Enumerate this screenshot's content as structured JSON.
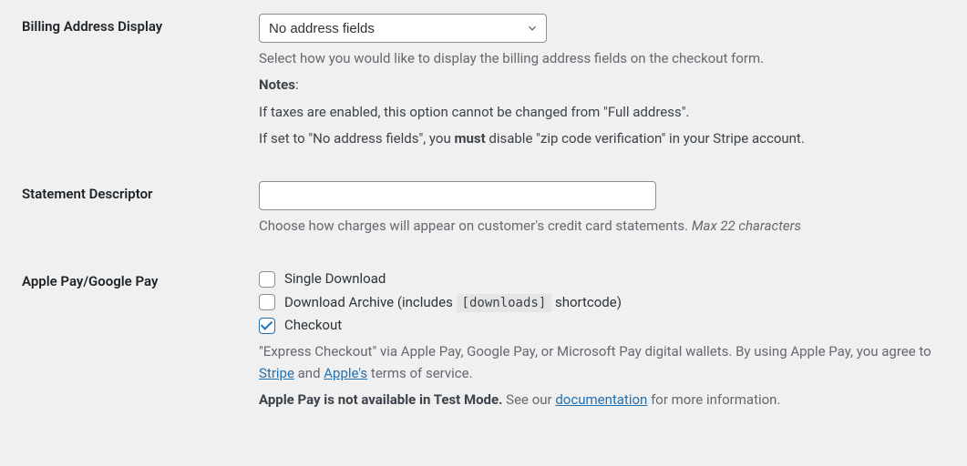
{
  "billing": {
    "label": "Billing Address Display",
    "select_value": "No address fields",
    "desc1": "Select how you would like to display the billing address fields on the checkout form.",
    "notes_label": "Notes",
    "notes_colon": ":",
    "note1": "If taxes are enabled, this option cannot be changed from \"Full address\".",
    "note2_a": "If set to \"No address fields\", you ",
    "note2_strong": "must",
    "note2_b": " disable \"zip code verification\" in your Stripe account."
  },
  "statement": {
    "label": "Statement Descriptor",
    "value": "",
    "desc_a": "Choose how charges will appear on customer's credit card statements. ",
    "desc_italic": "Max 22 characters"
  },
  "applepay": {
    "label": "Apple Pay/Google Pay",
    "cb1_label": "Single Download",
    "cb1_checked": false,
    "cb2_a": "Download Archive (includes ",
    "cb2_code": "[downloads]",
    "cb2_b": " shortcode)",
    "cb2_checked": false,
    "cb3_label": "Checkout",
    "cb3_checked": true,
    "desc1_a": "\"Express Checkout\" via Apple Pay, Google Pay, or Microsoft Pay digital wallets. By using Apple Pay, you agree to ",
    "link_stripe": "Stripe",
    "desc1_and": " and ",
    "link_apple": "Apple's",
    "desc1_b": " terms of service.",
    "desc2_strong": "Apple Pay is not available in Test Mode.",
    "desc2_a": " See our ",
    "link_doc": "documentation",
    "desc2_b": " for more information."
  }
}
